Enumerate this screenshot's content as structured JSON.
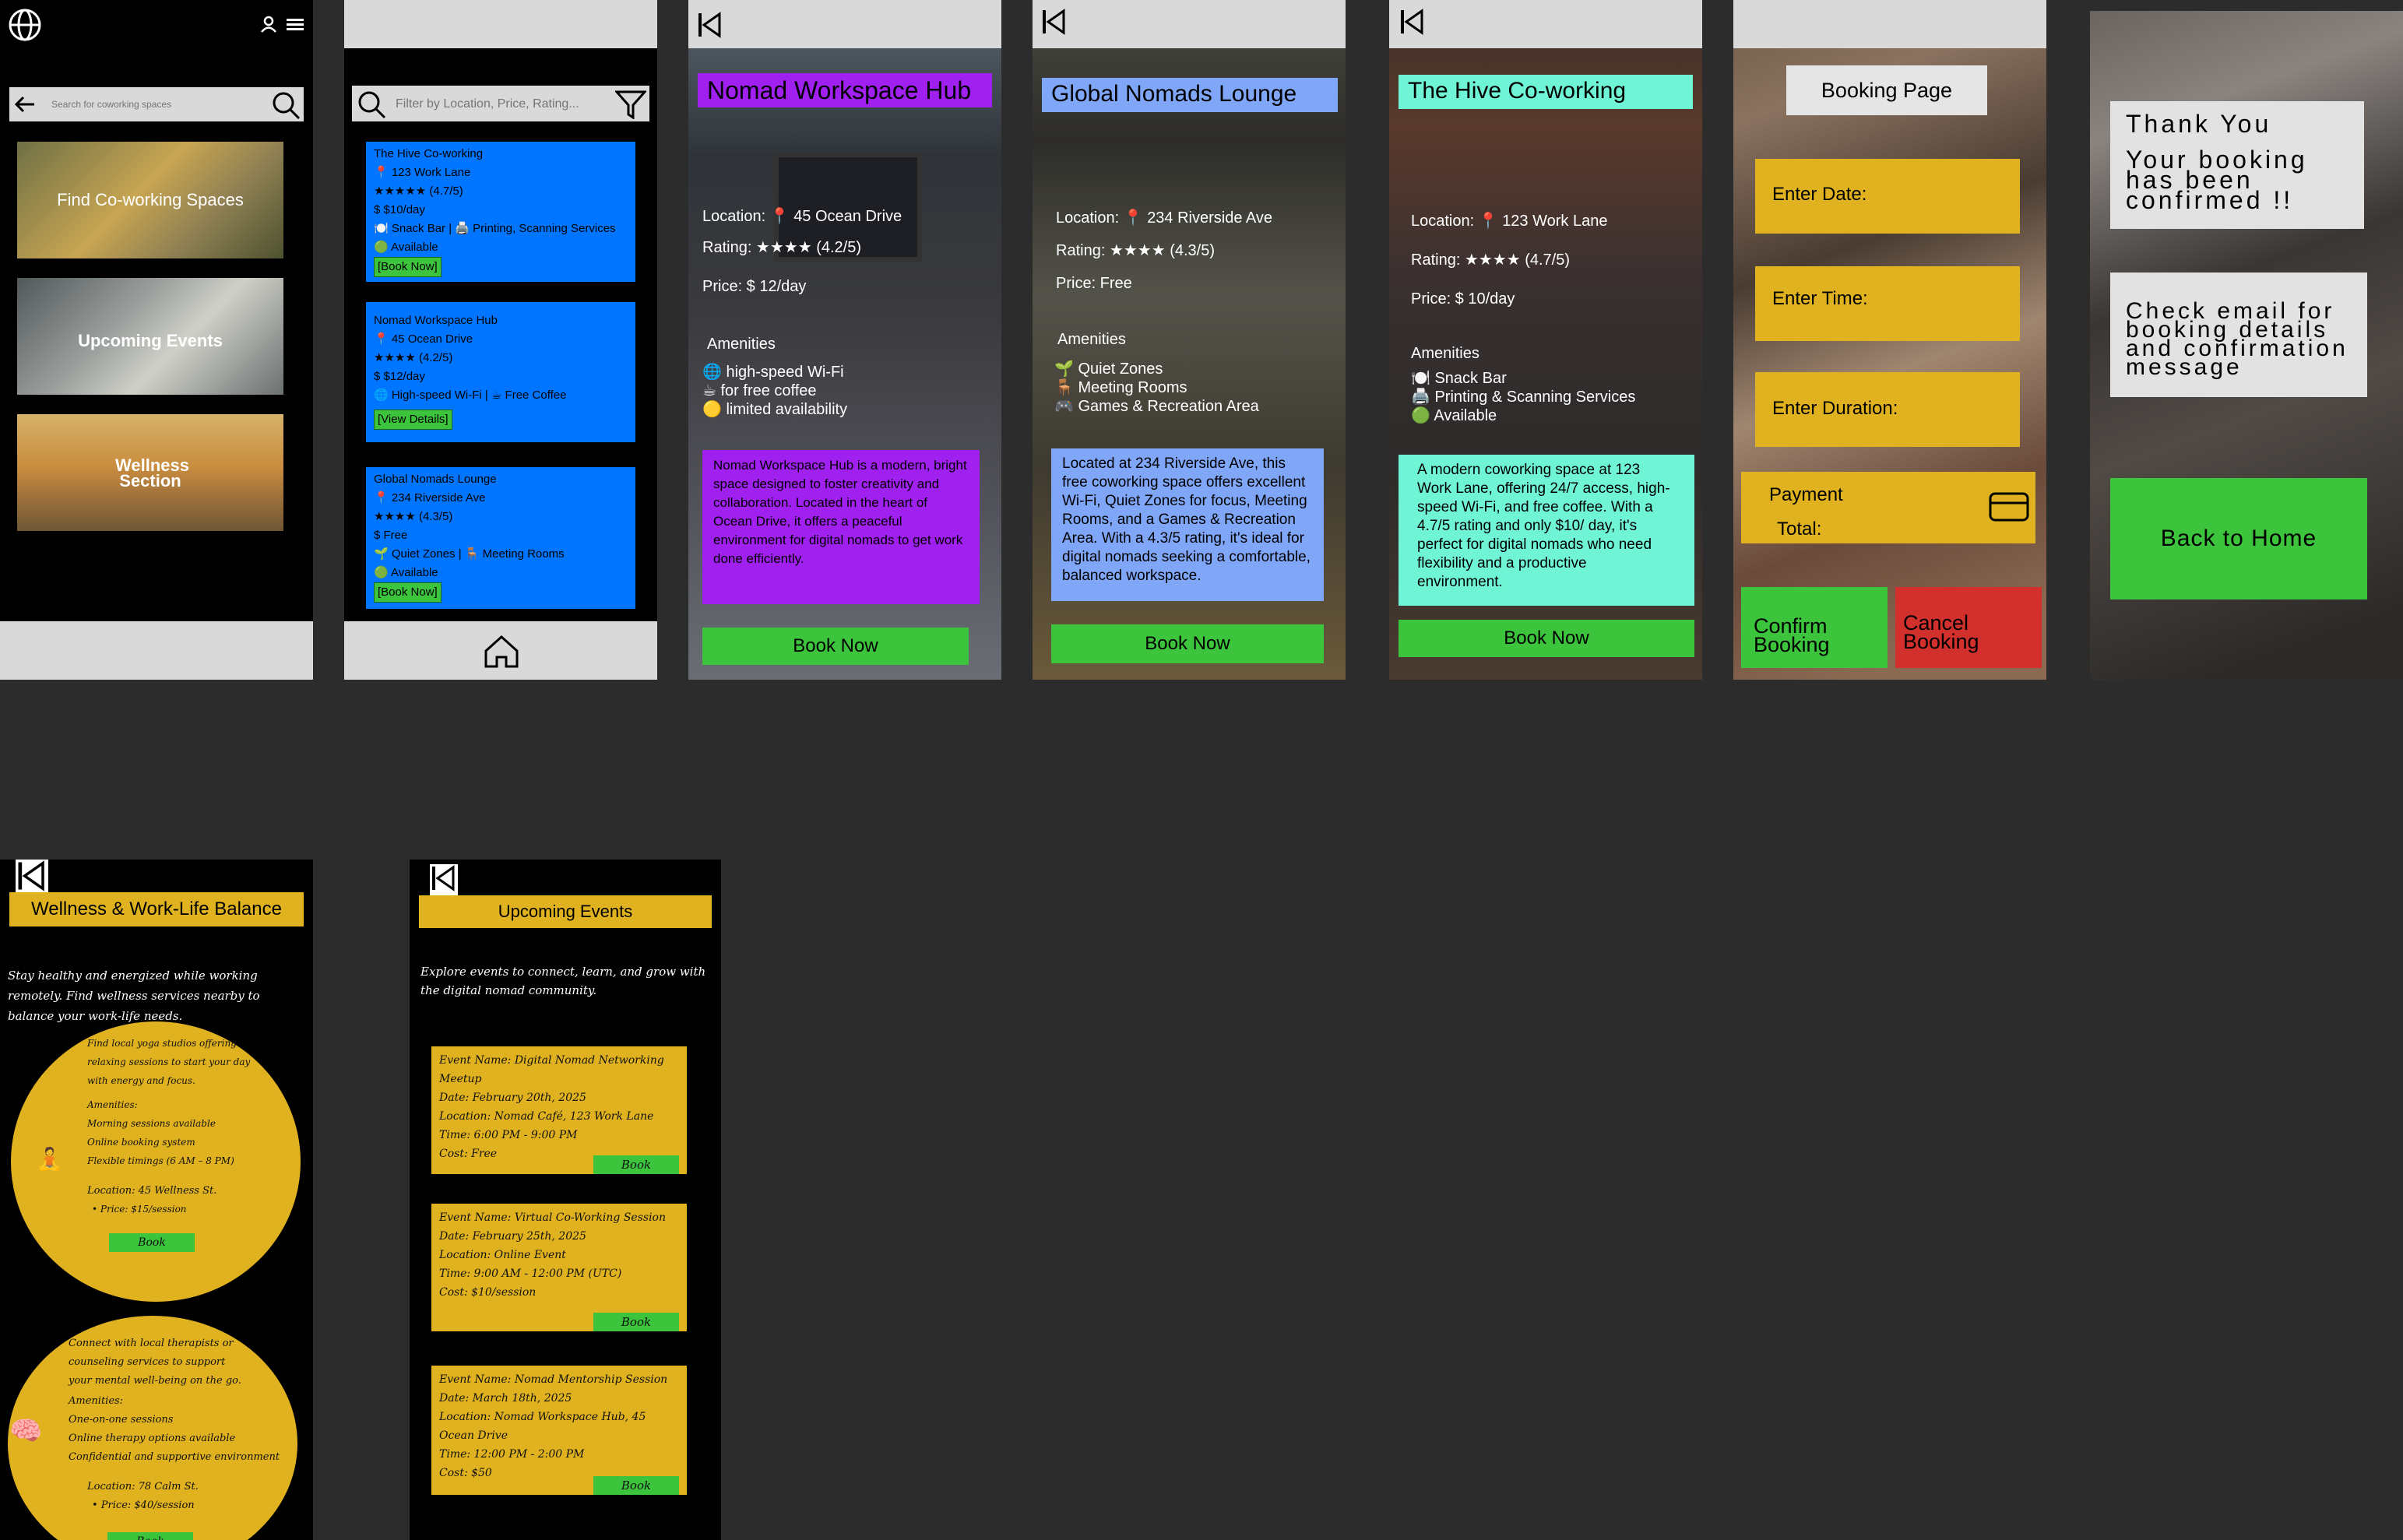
{
  "home": {
    "search_placeholder": "Search for coworking spaces",
    "tiles": [
      "Find Co-working Spaces",
      "Upcoming Events",
      "Wellness Section"
    ]
  },
  "listing": {
    "filter_placeholder": "Filter by Location, Price, Rating...",
    "cards": [
      {
        "name": "The Hive Co-working",
        "location": "📍 123 Work Lane",
        "rating": "★★★★★ (4.7/5)",
        "price": "$ $10/day",
        "amenities": "🍽️ Snack Bar | 🖨️ Printing, Scanning Services",
        "status": "🟢 Available",
        "button": "[Book Now]"
      },
      {
        "name": "Nomad Workspace Hub",
        "location": "📍 45 Ocean Drive",
        "rating": "★★★★ (4.2/5)",
        "price": "$ $12/day",
        "amenities": "🌐 High-speed Wi-Fi | ☕ Free Coffee",
        "button": "[View Details]"
      },
      {
        "name": "Global Nomads Lounge",
        "location": "📍 234 Riverside Ave",
        "rating": "★★★★ (4.3/5)",
        "price": "$ Free",
        "amenities": "🌱 Quiet Zones | 🪑 Meeting Rooms",
        "status": "🟢 Available",
        "button": "[Book Now]"
      }
    ]
  },
  "nomad": {
    "title": "Nomad Workspace Hub",
    "location": "Location: 📍 45 Ocean Drive",
    "rating": "Rating: ★★★★ (4.2/5)",
    "price": "Price: $ 12/day",
    "amen_title": "Amenities",
    "amenities": [
      "🌐 high-speed Wi-Fi",
      "☕ for free coffee",
      "🟡 limited availability"
    ],
    "description": "Nomad Workspace Hub is a modern, bright space designed to foster creativity and collaboration. Located in the heart of Ocean Drive, it offers a peaceful environment for digital nomads to get work done efficiently.",
    "book": "Book Now"
  },
  "global": {
    "title": "Global Nomads Lounge",
    "location": "Location: 📍 234 Riverside Ave",
    "rating": "Rating: ★★★★ (4.3/5)",
    "price": "Price: Free",
    "amen_title": "Amenities",
    "amenities": [
      "🌱 Quiet Zones",
      "🪑 Meeting Rooms",
      "🎮 Games & Recreation Area"
    ],
    "description": "Located at 234 Riverside Ave, this free coworking space offers excellent Wi-Fi, Quiet Zones for focus, Meeting Rooms, and a Games & Recreation Area. With a 4.3/5 rating, it's ideal for digital nomads seeking a comfortable, balanced workspace.",
    "book": "Book Now"
  },
  "hive": {
    "title": "The Hive Co-working",
    "location": "Location: 📍 123 Work Lane",
    "rating": "Rating: ★★★★ (4.7/5)",
    "price": "Price: $ 10/day",
    "amen_title": "Amenities",
    "amenities": [
      "🍽️ Snack Bar",
      "🖨️ Printing & Scanning Services",
      "🟢 Available"
    ],
    "description": "A modern coworking space at 123 Work Lane, offering 24/7 access, high-speed Wi-Fi, and free coffee. With a 4.7/5 rating and only $10/ day, it's perfect for digital nomads who need flexibility and a productive environment.",
    "book": "Book Now"
  },
  "booking": {
    "title": "Booking Page",
    "date": "Enter Date:",
    "time": "Enter Time:",
    "duration": "Enter Duration:",
    "payment": "Payment",
    "total": "Total:",
    "confirm": "Confirm Booking",
    "cancel": "Cancel Booking"
  },
  "thanks": {
    "title": "Thank You",
    "confirmed": "Your booking has been confirmed !!",
    "email": "Check email for booking details and confirmation message",
    "home": "Back to Home"
  },
  "wellness": {
    "title": "Wellness & Work-Life Balance",
    "intro": "Stay healthy and energized while working remotely. Find wellness services nearby to balance your work-life needs.",
    "items": [
      {
        "icon": "🧘",
        "text": "Find local yoga studios offering relaxing sessions to start your day with energy and focus.",
        "amen_title": "Amenities:",
        "amenities": [
          "Morning sessions available",
          "Online booking system",
          "Flexible timings (6 AM – 8 PM)"
        ],
        "location": "Location: 45 Wellness St.",
        "price": "• Price: $15/session",
        "book": "Book"
      },
      {
        "icon": "🧠",
        "text": "Connect with local therapists or counseling services to support your mental well-being on the go.",
        "amen_title": "Amenities:",
        "amenities": [
          "One-on-one sessions",
          "Online therapy options available",
          "Confidential and supportive environment"
        ],
        "location": "Location: 78 Calm St.",
        "price": "• Price: $40/session",
        "book": "Book"
      }
    ]
  },
  "events": {
    "title": "Upcoming Events",
    "intro": "Explore events to connect, learn, and grow with the digital nomad community.",
    "items": [
      {
        "name": "Event Name: Digital Nomad Networking Meetup",
        "date": "Date: February 20th, 2025",
        "location": "Location: Nomad Café, 123 Work Lane",
        "time": "Time: 6:00 PM - 9:00 PM",
        "cost": "Cost: Free",
        "book": "Book"
      },
      {
        "name": "Event Name: Virtual Co-Working Session",
        "date": "Date: February 25th, 2025",
        "location": "Location: Online Event",
        "time": "Time: 9:00 AM - 12:00 PM (UTC)",
        "cost": "Cost: $10/session",
        "book": "Book"
      },
      {
        "name": "Event Name: Nomad Mentorship Session",
        "date": "Date: March 18th, 2025",
        "location": "Location: Nomad Workspace Hub, 45 Ocean Drive",
        "time": "Time: 12:00 PM - 2:00 PM",
        "cost": "Cost: $50",
        "book": "Book"
      }
    ]
  },
  "colors": {
    "background": "#2c2c2c",
    "bar": "#d9d9d9",
    "blue": "#0075ff",
    "purple": "#a020f0",
    "periwinkle": "#80a6f8",
    "aqua": "#6ff5d5",
    "gold": "#e0b21f",
    "green": "#3cc53c",
    "red": "#d2302c"
  }
}
